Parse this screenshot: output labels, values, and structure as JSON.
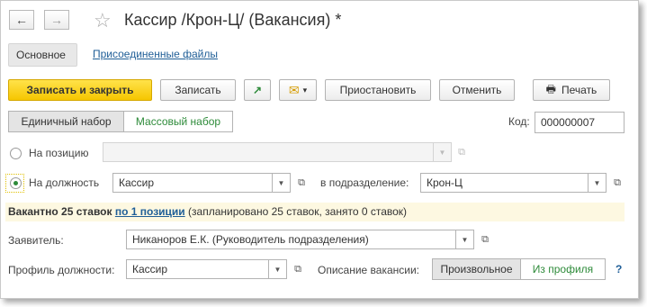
{
  "window": {
    "title": "Кассир /Крон-Ц/ (Вакансия) *",
    "back_icon": "←",
    "forward_icon": "→",
    "star_icon": "☆"
  },
  "tabs": {
    "main": "Основное",
    "files": "Присоединенные файлы"
  },
  "toolbar": {
    "save_close": "Записать и закрыть",
    "save": "Записать",
    "open_icon": "↗",
    "mail_icon": "✉",
    "mail_dropdown": "▾",
    "suspend": "Приостановить",
    "cancel": "Отменить",
    "print": "Печать",
    "print_icon": "🖶"
  },
  "form": {
    "set_single": "Единичный набор",
    "set_mass": "Массовый набор",
    "code_label": "Код:",
    "code_value": "000000007",
    "position_radio_label": "На позицию",
    "position_value": "",
    "job_radio_label": "На должность",
    "job_value": "Кассир",
    "dept_label": "в подразделение:",
    "dept_value": "Крон-Ц",
    "banner_count": "Вакантно 25 ставок",
    "banner_link": "по 1 позиции",
    "banner_note": "(запланировано 25 ставок, занято 0 ставок)",
    "applicant_label": "Заявитель:",
    "applicant_value": "Никаноров Е.К. (Руководитель подразделения)",
    "profile_label": "Профиль должности:",
    "profile_value": "Кассир",
    "desc_label": "Описание вакансии:",
    "desc_free": "Произвольное",
    "desc_profile": "Из профиля",
    "help": "?",
    "dropdown_glyph": "▼",
    "open_glyph": "⧉"
  }
}
